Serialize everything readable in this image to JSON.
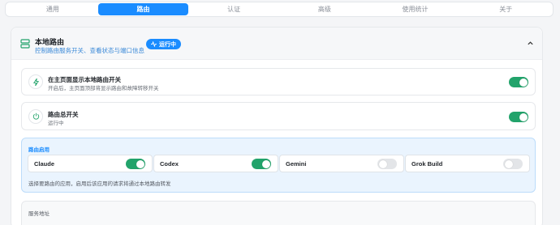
{
  "tabs": [
    {
      "label": "通用",
      "active": false
    },
    {
      "label": "路由",
      "active": true
    },
    {
      "label": "认证",
      "active": false
    },
    {
      "label": "高级",
      "active": false
    },
    {
      "label": "使用统计",
      "active": false
    },
    {
      "label": "关于",
      "active": false
    }
  ],
  "section": {
    "title": "本地路由",
    "subtitle": "控制路由服务开关、查看状态与端口信息",
    "status_badge": "运行中",
    "icon": "server-icon",
    "collapse_icon": "chevron-up-icon"
  },
  "show_switch": {
    "title": "在主页面显示本地路由开关",
    "desc": "开启后，主页面顶部将显示路由和故障转移开关",
    "enabled": true,
    "icon": "zap-icon"
  },
  "master_switch": {
    "title": "路由总开关",
    "desc": "运行中",
    "enabled": true,
    "icon": "power-icon"
  },
  "apps": {
    "title": "路由启用",
    "items": [
      {
        "name": "Claude",
        "enabled": true
      },
      {
        "name": "Codex",
        "enabled": true
      },
      {
        "name": "Gemini",
        "enabled": false
      },
      {
        "name": "Grok Build",
        "enabled": false
      }
    ],
    "note": "选择要路由的应用，启用后该应用的请求将通过本地路由转发"
  },
  "service": {
    "title": "服务地址"
  },
  "colors": {
    "accent": "#1a8cff",
    "toggle_on": "#22a36b",
    "toggle_off": "#e3e5e8",
    "apps_bg": "#eaf4fe"
  }
}
